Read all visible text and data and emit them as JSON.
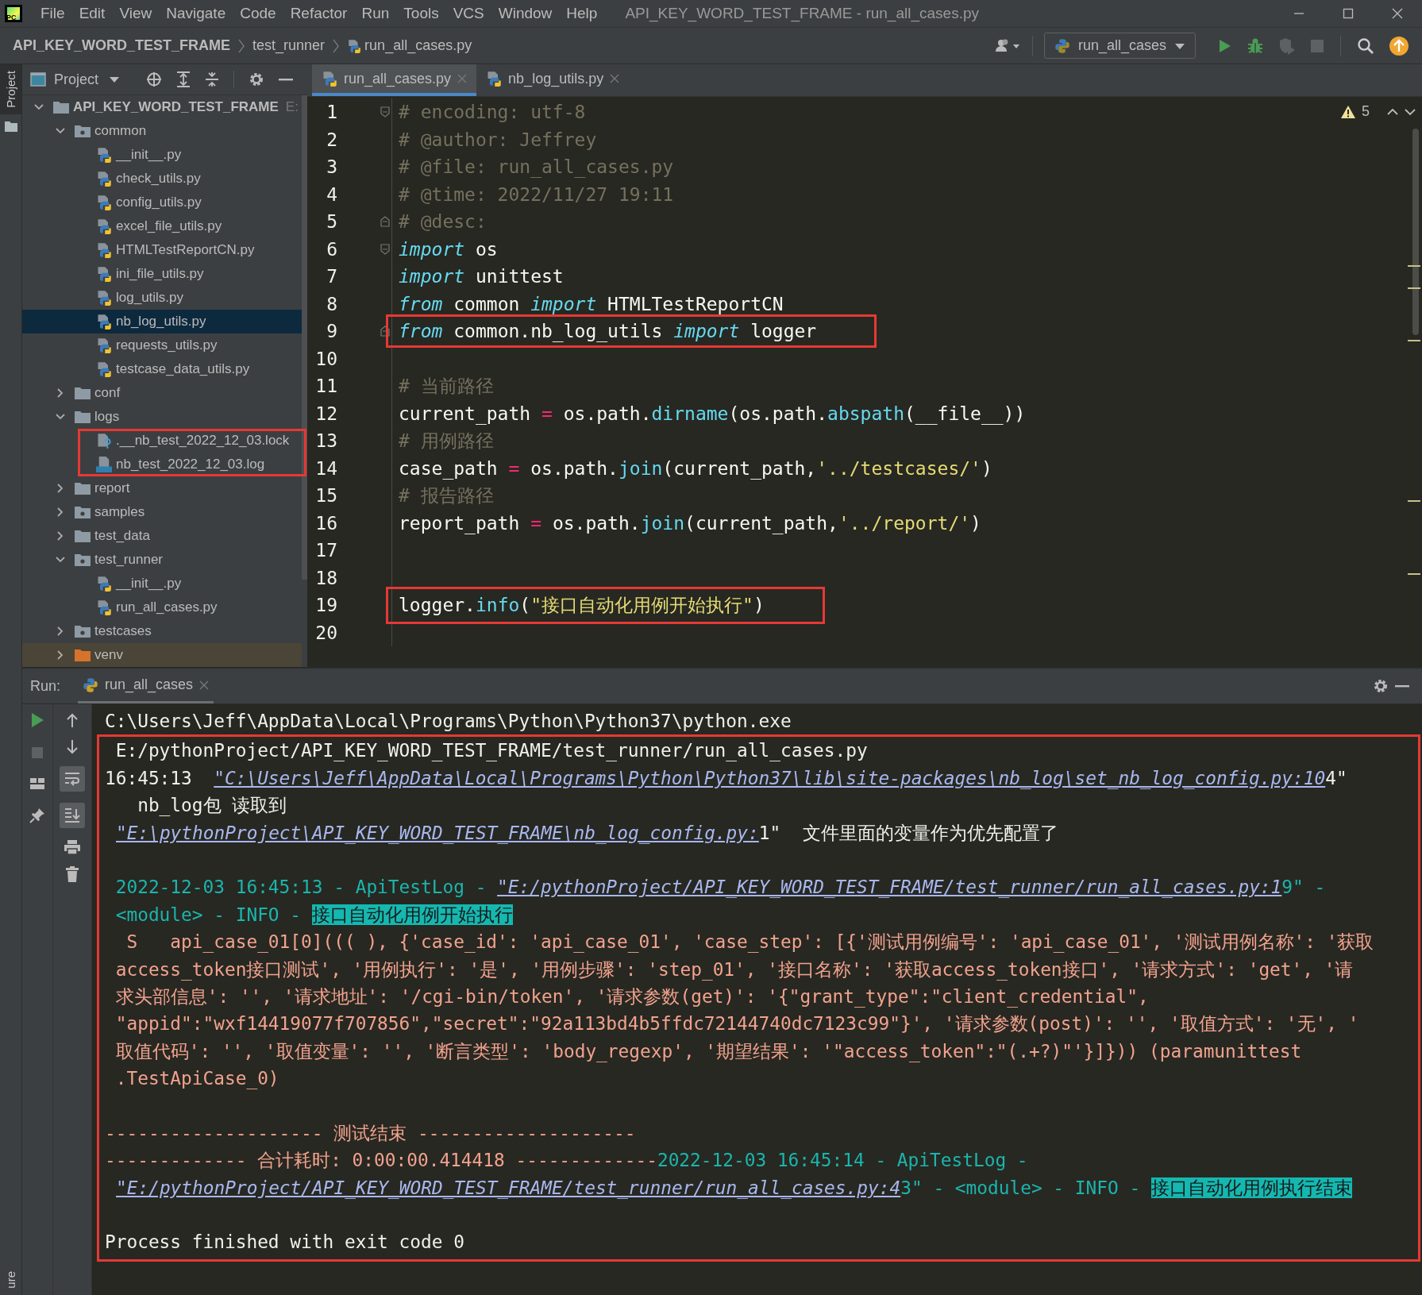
{
  "app_logo": "PC",
  "menu_bar": {
    "items": [
      "File",
      "Edit",
      "View",
      "Navigate",
      "Code",
      "Refactor",
      "Run",
      "Tools",
      "VCS",
      "Window",
      "Help"
    ],
    "title": "API_KEY_WORD_TEST_FRAME - run_all_cases.py"
  },
  "breadcrumbs": [
    "API_KEY_WORD_TEST_FRAME",
    "test_runner",
    "run_all_cases.py"
  ],
  "run_config": {
    "label": "run_all_cases"
  },
  "left_stripe": {
    "tabs": [
      {
        "label": "Project",
        "selected": true
      }
    ],
    "bottom_tab": "ure"
  },
  "project_panel": {
    "title": "Project",
    "tree": [
      {
        "label": "API_KEY_WORD_TEST_FRAME",
        "location": "E:",
        "kind": "project",
        "expanded": true,
        "selected": false,
        "children": [
          {
            "label": "common",
            "kind": "package",
            "expanded": true,
            "selected": false,
            "children": [
              {
                "label": "__init__.py",
                "kind": "python",
                "selected": false
              },
              {
                "label": "check_utils.py",
                "kind": "python",
                "selected": false
              },
              {
                "label": "config_utils.py",
                "kind": "python",
                "selected": false
              },
              {
                "label": "excel_file_utils.py",
                "kind": "python",
                "selected": false
              },
              {
                "label": "HTMLTestReportCN.py",
                "kind": "python",
                "selected": false
              },
              {
                "label": "ini_file_utils.py",
                "kind": "python",
                "selected": false
              },
              {
                "label": "log_utils.py",
                "kind": "python",
                "selected": false
              },
              {
                "label": "nb_log_utils.py",
                "kind": "python",
                "selected": true
              },
              {
                "label": "requests_utils.py",
                "kind": "python",
                "selected": false
              },
              {
                "label": "testcase_data_utils.py",
                "kind": "python",
                "selected": false
              }
            ]
          },
          {
            "label": "conf",
            "kind": "folder",
            "expanded": false,
            "selected": false
          },
          {
            "label": "logs",
            "kind": "folder",
            "expanded": true,
            "selected": false,
            "children": [
              {
                "label": ".__nb_test_2022_12_03.lock",
                "kind": "unknown",
                "selected": false,
                "annotated": true
              },
              {
                "label": "nb_test_2022_12_03.log",
                "kind": "log",
                "selected": false,
                "annotated": true
              }
            ]
          },
          {
            "label": "report",
            "kind": "folder",
            "expanded": false,
            "selected": false
          },
          {
            "label": "samples",
            "kind": "package",
            "expanded": false,
            "selected": false
          },
          {
            "label": "test_data",
            "kind": "folder",
            "expanded": false,
            "selected": false
          },
          {
            "label": "test_runner",
            "kind": "package",
            "expanded": true,
            "selected": false,
            "children": [
              {
                "label": "__init__.py",
                "kind": "python",
                "selected": false
              },
              {
                "label": "run_all_cases.py",
                "kind": "python",
                "selected": false
              }
            ]
          },
          {
            "label": "testcases",
            "kind": "package",
            "expanded": false,
            "selected": false
          },
          {
            "label": "venv",
            "kind": "excluded",
            "expanded": false,
            "selected": false
          }
        ]
      }
    ]
  },
  "editor": {
    "tabs": [
      {
        "label": "run_all_cases.py",
        "selected": true
      },
      {
        "label": "nb_log_utils.py",
        "selected": false
      }
    ],
    "warnings": "5",
    "lines": [
      {
        "number": "1",
        "fold_start": true,
        "fold_end": false,
        "annotated": false,
        "segments": [
          {
            "kind": "comment",
            "text": "# encoding: utf-8"
          }
        ]
      },
      {
        "number": "2",
        "fold_start": false,
        "fold_end": false,
        "annotated": false,
        "segments": [
          {
            "kind": "comment",
            "text": "# @author: Jeffrey"
          }
        ]
      },
      {
        "number": "3",
        "fold_start": false,
        "fold_end": false,
        "annotated": false,
        "segments": [
          {
            "kind": "comment",
            "text": "# @file: run_all_cases.py"
          }
        ]
      },
      {
        "number": "4",
        "fold_start": false,
        "fold_end": false,
        "annotated": false,
        "segments": [
          {
            "kind": "comment",
            "text": "# @time: 2022/11/27 19:11"
          }
        ]
      },
      {
        "number": "5",
        "fold_start": false,
        "fold_end": true,
        "annotated": false,
        "segments": [
          {
            "kind": "comment",
            "text": "# @desc:"
          }
        ]
      },
      {
        "number": "6",
        "fold_start": true,
        "fold_end": false,
        "annotated": false,
        "segments": [
          {
            "kind": "keyword",
            "text": "import"
          },
          {
            "kind": "plain",
            "text": " os"
          }
        ]
      },
      {
        "number": "7",
        "fold_start": false,
        "fold_end": false,
        "annotated": false,
        "segments": [
          {
            "kind": "keyword",
            "text": "import"
          },
          {
            "kind": "plain",
            "text": " unittest"
          }
        ]
      },
      {
        "number": "8",
        "fold_start": false,
        "fold_end": false,
        "annotated": false,
        "segments": [
          {
            "kind": "keyword",
            "text": "from"
          },
          {
            "kind": "plain",
            "text": " common "
          },
          {
            "kind": "keyword",
            "text": "import"
          },
          {
            "kind": "plain",
            "text": " HTMLTestReportCN"
          }
        ]
      },
      {
        "number": "9",
        "fold_start": false,
        "fold_end": true,
        "annotated": true,
        "segments": [
          {
            "kind": "keyword",
            "text": "from"
          },
          {
            "kind": "plain",
            "text": " common.nb_log_utils "
          },
          {
            "kind": "keyword",
            "text": "import"
          },
          {
            "kind": "plain",
            "text": " logger"
          }
        ]
      },
      {
        "number": "10",
        "fold_start": false,
        "fold_end": false
      },
      {
        "number": "11",
        "fold_start": false,
        "fold_end": false,
        "annotated": false,
        "segments": [
          {
            "kind": "comment",
            "text": "# 当前路径"
          }
        ]
      },
      {
        "number": "12",
        "fold_start": false,
        "fold_end": false,
        "annotated": false,
        "segments": [
          {
            "kind": "plain",
            "text": "current_path "
          },
          {
            "kind": "operator",
            "text": "="
          },
          {
            "kind": "plain",
            "text": " os.path."
          },
          {
            "kind": "function",
            "text": "dirname"
          },
          {
            "kind": "plain",
            "text": "(os.path."
          },
          {
            "kind": "function",
            "text": "abspath"
          },
          {
            "kind": "plain",
            "text": "(__file__))"
          }
        ]
      },
      {
        "number": "13",
        "fold_start": false,
        "fold_end": false,
        "annotated": false,
        "segments": [
          {
            "kind": "comment",
            "text": "# 用例路径"
          }
        ]
      },
      {
        "number": "14",
        "fold_start": false,
        "fold_end": false,
        "annotated": false,
        "segments": [
          {
            "kind": "plain",
            "text": "case_path "
          },
          {
            "kind": "operator",
            "text": "="
          },
          {
            "kind": "plain",
            "text": " os.path."
          },
          {
            "kind": "function",
            "text": "join"
          },
          {
            "kind": "plain",
            "text": "(current_path,"
          },
          {
            "kind": "string",
            "text": "'../testcases/'"
          },
          {
            "kind": "plain",
            "text": ")"
          }
        ]
      },
      {
        "number": "15",
        "fold_start": false,
        "fold_end": false,
        "annotated": false,
        "segments": [
          {
            "kind": "comment",
            "text": "# 报告路径"
          }
        ]
      },
      {
        "number": "16",
        "fold_start": false,
        "fold_end": false,
        "annotated": false,
        "segments": [
          {
            "kind": "plain",
            "text": "report_path "
          },
          {
            "kind": "operator",
            "text": "="
          },
          {
            "kind": "plain",
            "text": " os.path."
          },
          {
            "kind": "function",
            "text": "join"
          },
          {
            "kind": "plain",
            "text": "(current_path,"
          },
          {
            "kind": "string",
            "text": "'../report/'"
          },
          {
            "kind": "plain",
            "text": ")"
          }
        ]
      },
      {
        "number": "17",
        "fold_start": false,
        "fold_end": false
      },
      {
        "number": "18",
        "fold_start": false,
        "fold_end": false
      },
      {
        "number": "19",
        "fold_start": false,
        "fold_end": false,
        "annotated": true,
        "segments": [
          {
            "kind": "plain",
            "text": "logger."
          },
          {
            "kind": "function",
            "text": "info"
          },
          {
            "kind": "plain",
            "text": "("
          },
          {
            "kind": "string",
            "text": "\"接口自动化用例开始执行\""
          },
          {
            "kind": "plain",
            "text": ")"
          }
        ]
      },
      {
        "number": "20",
        "fold_start": false,
        "fold_end": false
      }
    ]
  },
  "run_panel": {
    "label": "Run:",
    "tab": "run_all_cases",
    "toggles": {
      "soft_wrap": true,
      "scroll_to_end": true
    },
    "lines": [
      {
        "kind": "text",
        "segments": [
          {
            "kind": "text",
            "text": "C:\\Users\\Jeff\\AppData\\Local\\Programs\\Python\\Python37\\python.exe"
          }
        ]
      }
    ],
    "framed_lines": [
      {
        "kind": "text",
        "segments": [
          {
            "kind": "text",
            "text": " E:/pythonProject/API_KEY_WORD_TEST_FRAME/test_runner/run_all_cases.py"
          }
        ]
      },
      {
        "kind": "text",
        "segments": [
          {
            "kind": "text",
            "text": "16:45:13  "
          },
          {
            "kind": "link",
            "text": "\"C:\\Users\\Jeff\\AppData\\Local\\Programs\\Python\\Python37\\lib\\site-packages\\nb_log\\set_nb_log_config.py:10"
          },
          {
            "kind": "text",
            "text": "4\""
          }
        ]
      },
      {
        "kind": "text",
        "segments": [
          {
            "kind": "text",
            "text": "   nb_log包 读取到"
          }
        ]
      },
      {
        "kind": "text",
        "segments": [
          {
            "kind": "link",
            "text": "\"E:\\pythonProject\\API_KEY_WORD_TEST_FRAME\\nb_log_config.py:"
          },
          {
            "kind": "text",
            "text": "1\"  文件里面的变量作为优先配置了"
          }
        ]
      },
      {
        "kind": "blank"
      },
      {
        "kind": "text",
        "segments": [
          {
            "kind": "log",
            "text": " 2022-12-03 16:45:13 - ApiTestLog - "
          },
          {
            "kind": "link",
            "text": "\"E:/pythonProject/API_KEY_WORD_TEST_FRAME/test_runner/run_all_cases.py:1"
          },
          {
            "kind": "log",
            "text": "9\" -"
          }
        ]
      },
      {
        "kind": "text",
        "segments": [
          {
            "kind": "log",
            "text": " <module> - INFO - "
          },
          {
            "kind": "highlight",
            "text": "接口自动化用例开始执行"
          }
        ]
      },
      {
        "kind": "text",
        "segments": [
          {
            "kind": "error",
            "text": "  S   api_case_01[0]((( ), {'case_id': 'api_case_01', 'case_step': [{'测试用例编号': 'api_case_01', '测试用例名称': '获取"
          }
        ]
      },
      {
        "kind": "text",
        "segments": [
          {
            "kind": "error",
            "text": " access_token接口测试', '用例执行': '是', '用例步骤': 'step_01', '接口名称': '获取access_token接口', '请求方式': 'get', '请"
          }
        ]
      },
      {
        "kind": "text",
        "segments": [
          {
            "kind": "error",
            "text": " 求头部信息': '', '请求地址': '/cgi-bin/token', '请求参数(get)': '{\"grant_type\":\"client_credential\","
          }
        ]
      },
      {
        "kind": "text",
        "segments": [
          {
            "kind": "error",
            "text": " \"appid\":\"wxf14419077f707856\",\"secret\":\"92a113bd4b5ffdc72144740dc7123c99\"}', '请求参数(post)': '', '取值方式': '无', '"
          }
        ]
      },
      {
        "kind": "text",
        "segments": [
          {
            "kind": "error",
            "text": " 取值代码': '', '取值变量': '', '断言类型': 'body_regexp', '期望结果': '\"access_token\":\"(.+?)\"'}]})) (paramunittest"
          }
        ]
      },
      {
        "kind": "text",
        "segments": [
          {
            "kind": "error",
            "text": " .TestApiCase_0)"
          }
        ]
      },
      {
        "kind": "blank"
      },
      {
        "kind": "text",
        "segments": [
          {
            "kind": "error",
            "text": "-------------------- 测试结束 --------------------"
          }
        ]
      },
      {
        "kind": "text",
        "segments": [
          {
            "kind": "error",
            "text": "------------- 合计耗时: 0:00:00.414418 -------------"
          },
          {
            "kind": "log",
            "text": "2022-12-03 16:45:14 - ApiTestLog -"
          }
        ]
      },
      {
        "kind": "text",
        "segments": [
          {
            "kind": "link",
            "text": "\"E:/pythonProject/API_KEY_WORD_TEST_FRAME/test_runner/run_all_cases.py:4"
          },
          {
            "kind": "log",
            "text": "3\" - <module> - INFO - "
          },
          {
            "kind": "highlight",
            "text": "接口自动化用例执行结束"
          }
        ]
      },
      {
        "kind": "blank"
      },
      {
        "kind": "text",
        "segments": [
          {
            "kind": "text",
            "text": "Process finished with exit code 0"
          }
        ]
      }
    ]
  }
}
